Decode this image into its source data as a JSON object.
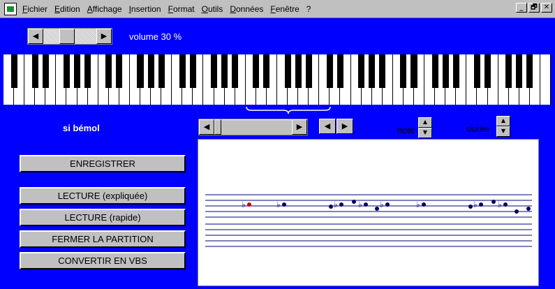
{
  "menu": {
    "items": [
      "Fichier",
      "Edition",
      "Affichage",
      "Insertion",
      "Format",
      "Outils",
      "Données",
      "Fenêtre",
      "?"
    ]
  },
  "window_controls": {
    "minimize": "_",
    "restore": "🗗",
    "close": "✕"
  },
  "volume": {
    "label": "volume 30 %",
    "level": 0.3
  },
  "note_name": "si bémol",
  "spinners": {
    "note_label": "note",
    "duree_label": "durée"
  },
  "buttons": {
    "record": "ENREGISTRER",
    "play_explained": "LECTURE (expliquée)",
    "play_fast": "LECTURE (rapide)",
    "close_score": "FERMER LA PARTITION",
    "convert": "CONVERTIR EN VBS"
  },
  "score": {
    "notes": [
      {
        "flat": true,
        "color": "#cc0000"
      },
      {
        "flat": true,
        "color": "#000066"
      },
      {
        "flat": false,
        "color": "#000066"
      },
      {
        "flat": true,
        "color": "#000066"
      },
      {
        "flat": false,
        "color": "#000066"
      },
      {
        "flat": true,
        "color": "#000066"
      },
      {
        "flat": false,
        "color": "#000066"
      },
      {
        "flat": true,
        "color": "#000066"
      },
      {
        "flat": true,
        "color": "#000066"
      },
      {
        "flat": false,
        "color": "#000066"
      },
      {
        "flat": true,
        "color": "#000066"
      },
      {
        "flat": false,
        "color": "#000066"
      },
      {
        "flat": true,
        "color": "#000066"
      },
      {
        "flat": false,
        "color": "#000066"
      },
      {
        "flat": false,
        "color": "#000066"
      }
    ]
  },
  "colors": {
    "background": "#0000ff",
    "staff": "#000080",
    "highlight_note": "#cc0000"
  },
  "icons": {
    "arrow_left": "◀",
    "arrow_right": "▶",
    "arrow_up": "▲",
    "arrow_down": "▼",
    "flat": "♭"
  }
}
